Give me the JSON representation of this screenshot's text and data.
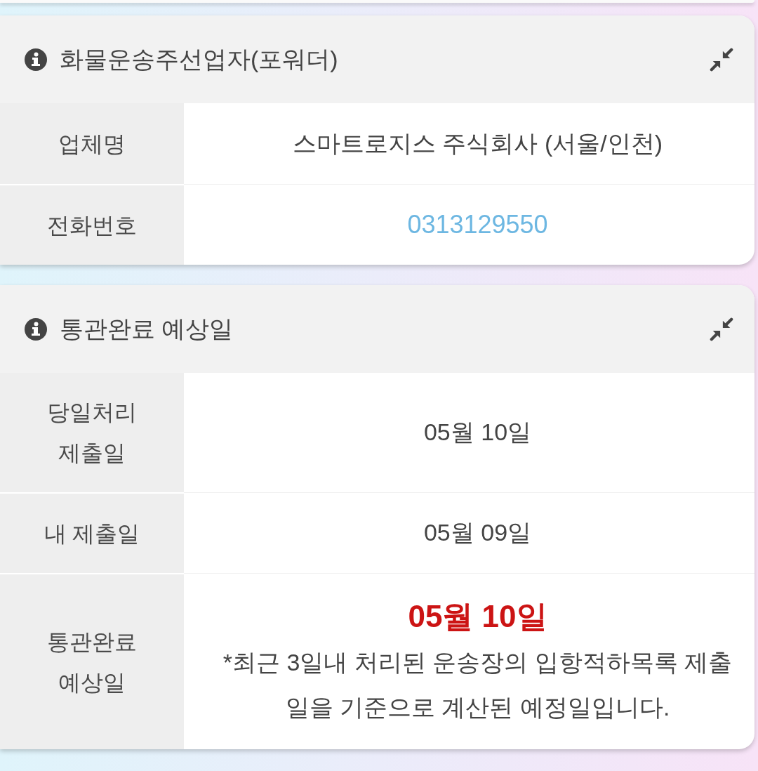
{
  "sections": [
    {
      "title": "화물운송주선업자(포워더)",
      "expanded": true,
      "rows": [
        {
          "kind": "text",
          "label": "업체명",
          "value": "스마트로지스 주식회사 (서울/인천)"
        },
        {
          "kind": "phone",
          "label": "전화번호",
          "value": "0313129550"
        }
      ]
    },
    {
      "title": "통관완료 예상일",
      "expanded": true,
      "rows": [
        {
          "kind": "text",
          "label": "당일처리\n제출일",
          "value": "05월 10일"
        },
        {
          "kind": "text",
          "label": "내 제출일",
          "value": "05월 09일"
        },
        {
          "kind": "highlight",
          "label": "통관완료\n예상일",
          "value": "05월 10일",
          "note": "*최근 3일내 처리된 운송장의 입항적하목록 제출일을 기준으로 계산된 예정일입니다."
        }
      ]
    }
  ]
}
